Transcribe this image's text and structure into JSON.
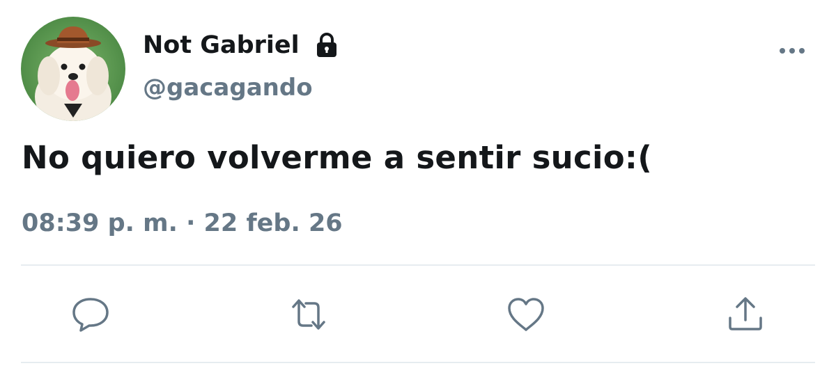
{
  "tweet": {
    "author": {
      "display_name": "Not Gabriel",
      "handle": "@gacagando",
      "protected": true
    },
    "text": "No quiero volverme a sentir sucio:(",
    "timestamp": "08:39 p. m. · 22 feb. 26"
  },
  "icons": {
    "lock": "lock-icon",
    "more": "more-dots-icon",
    "reply": "reply-bubble-icon",
    "retweet": "retweet-arrows-icon",
    "like": "heart-icon",
    "share": "share-upload-icon"
  },
  "colors": {
    "text_primary": "#14171a",
    "text_secondary": "#657786",
    "divider": "#e6ecf0"
  }
}
